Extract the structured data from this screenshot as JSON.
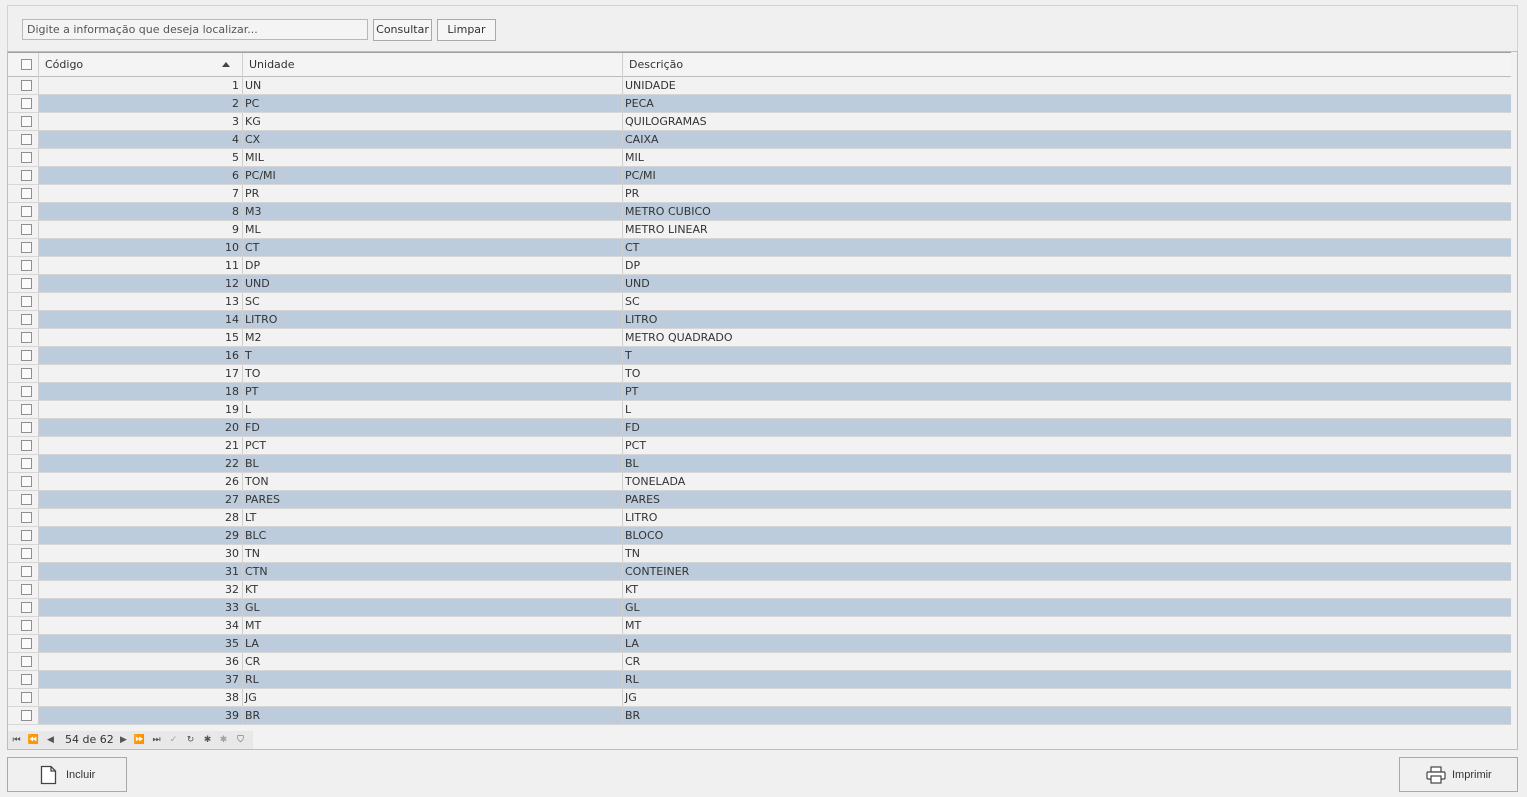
{
  "search": {
    "placeholder": "Digite a informação que deseja localizar..."
  },
  "toolbar": {
    "consultar_label": "Consultar",
    "limpar_label": "Limpar"
  },
  "grid": {
    "columns": [
      "Código",
      "Unidade",
      "Descrição"
    ],
    "rows": [
      {
        "codigo": "1",
        "unidade": "UN",
        "descricao": "UNIDADE"
      },
      {
        "codigo": "2",
        "unidade": "PC",
        "descricao": "PECA"
      },
      {
        "codigo": "3",
        "unidade": "KG",
        "descricao": "QUILOGRAMAS"
      },
      {
        "codigo": "4",
        "unidade": "CX",
        "descricao": "CAIXA"
      },
      {
        "codigo": "5",
        "unidade": "MIL",
        "descricao": "MIL"
      },
      {
        "codigo": "6",
        "unidade": "PC/MI",
        "descricao": "PC/MI"
      },
      {
        "codigo": "7",
        "unidade": "PR",
        "descricao": "PR"
      },
      {
        "codigo": "8",
        "unidade": "M3",
        "descricao": "METRO CUBICO"
      },
      {
        "codigo": "9",
        "unidade": "ML",
        "descricao": "METRO LINEAR"
      },
      {
        "codigo": "10",
        "unidade": "CT",
        "descricao": "CT"
      },
      {
        "codigo": "11",
        "unidade": "DP",
        "descricao": "DP"
      },
      {
        "codigo": "12",
        "unidade": "UND",
        "descricao": "UND"
      },
      {
        "codigo": "13",
        "unidade": "SC",
        "descricao": "SC"
      },
      {
        "codigo": "14",
        "unidade": "LITRO",
        "descricao": "LITRO"
      },
      {
        "codigo": "15",
        "unidade": "M2",
        "descricao": "METRO QUADRADO"
      },
      {
        "codigo": "16",
        "unidade": "T",
        "descricao": "T"
      },
      {
        "codigo": "17",
        "unidade": "TO",
        "descricao": "TO"
      },
      {
        "codigo": "18",
        "unidade": "PT",
        "descricao": "PT"
      },
      {
        "codigo": "19",
        "unidade": "L",
        "descricao": "L"
      },
      {
        "codigo": "20",
        "unidade": "FD",
        "descricao": "FD"
      },
      {
        "codigo": "21",
        "unidade": "PCT",
        "descricao": "PCT"
      },
      {
        "codigo": "22",
        "unidade": "BL",
        "descricao": "BL"
      },
      {
        "codigo": "26",
        "unidade": "TON",
        "descricao": "TONELADA"
      },
      {
        "codigo": "27",
        "unidade": "PARES",
        "descricao": "PARES"
      },
      {
        "codigo": "28",
        "unidade": "LT",
        "descricao": "LITRO"
      },
      {
        "codigo": "29",
        "unidade": "BLC",
        "descricao": "BLOCO"
      },
      {
        "codigo": "30",
        "unidade": "TN",
        "descricao": "TN"
      },
      {
        "codigo": "31",
        "unidade": "CTN",
        "descricao": "CONTEINER"
      },
      {
        "codigo": "32",
        "unidade": "KT",
        "descricao": "KT"
      },
      {
        "codigo": "33",
        "unidade": "GL",
        "descricao": "GL"
      },
      {
        "codigo": "34",
        "unidade": "MT",
        "descricao": "MT"
      },
      {
        "codigo": "35",
        "unidade": "LA",
        "descricao": "LA"
      },
      {
        "codigo": "36",
        "unidade": "CR",
        "descricao": "CR"
      },
      {
        "codigo": "37",
        "unidade": "RL",
        "descricao": "RL"
      },
      {
        "codigo": "38",
        "unidade": "JG",
        "descricao": "JG"
      },
      {
        "codigo": "39",
        "unidade": "BR",
        "descricao": "BR"
      }
    ]
  },
  "pager": {
    "text": "54 de 62"
  },
  "footer": {
    "incluir_label": "Incluir",
    "imprimir_label": "Imprimir"
  },
  "colors": {
    "row_alt": "#bcccdc",
    "row_normal": "#f2f2f2"
  }
}
